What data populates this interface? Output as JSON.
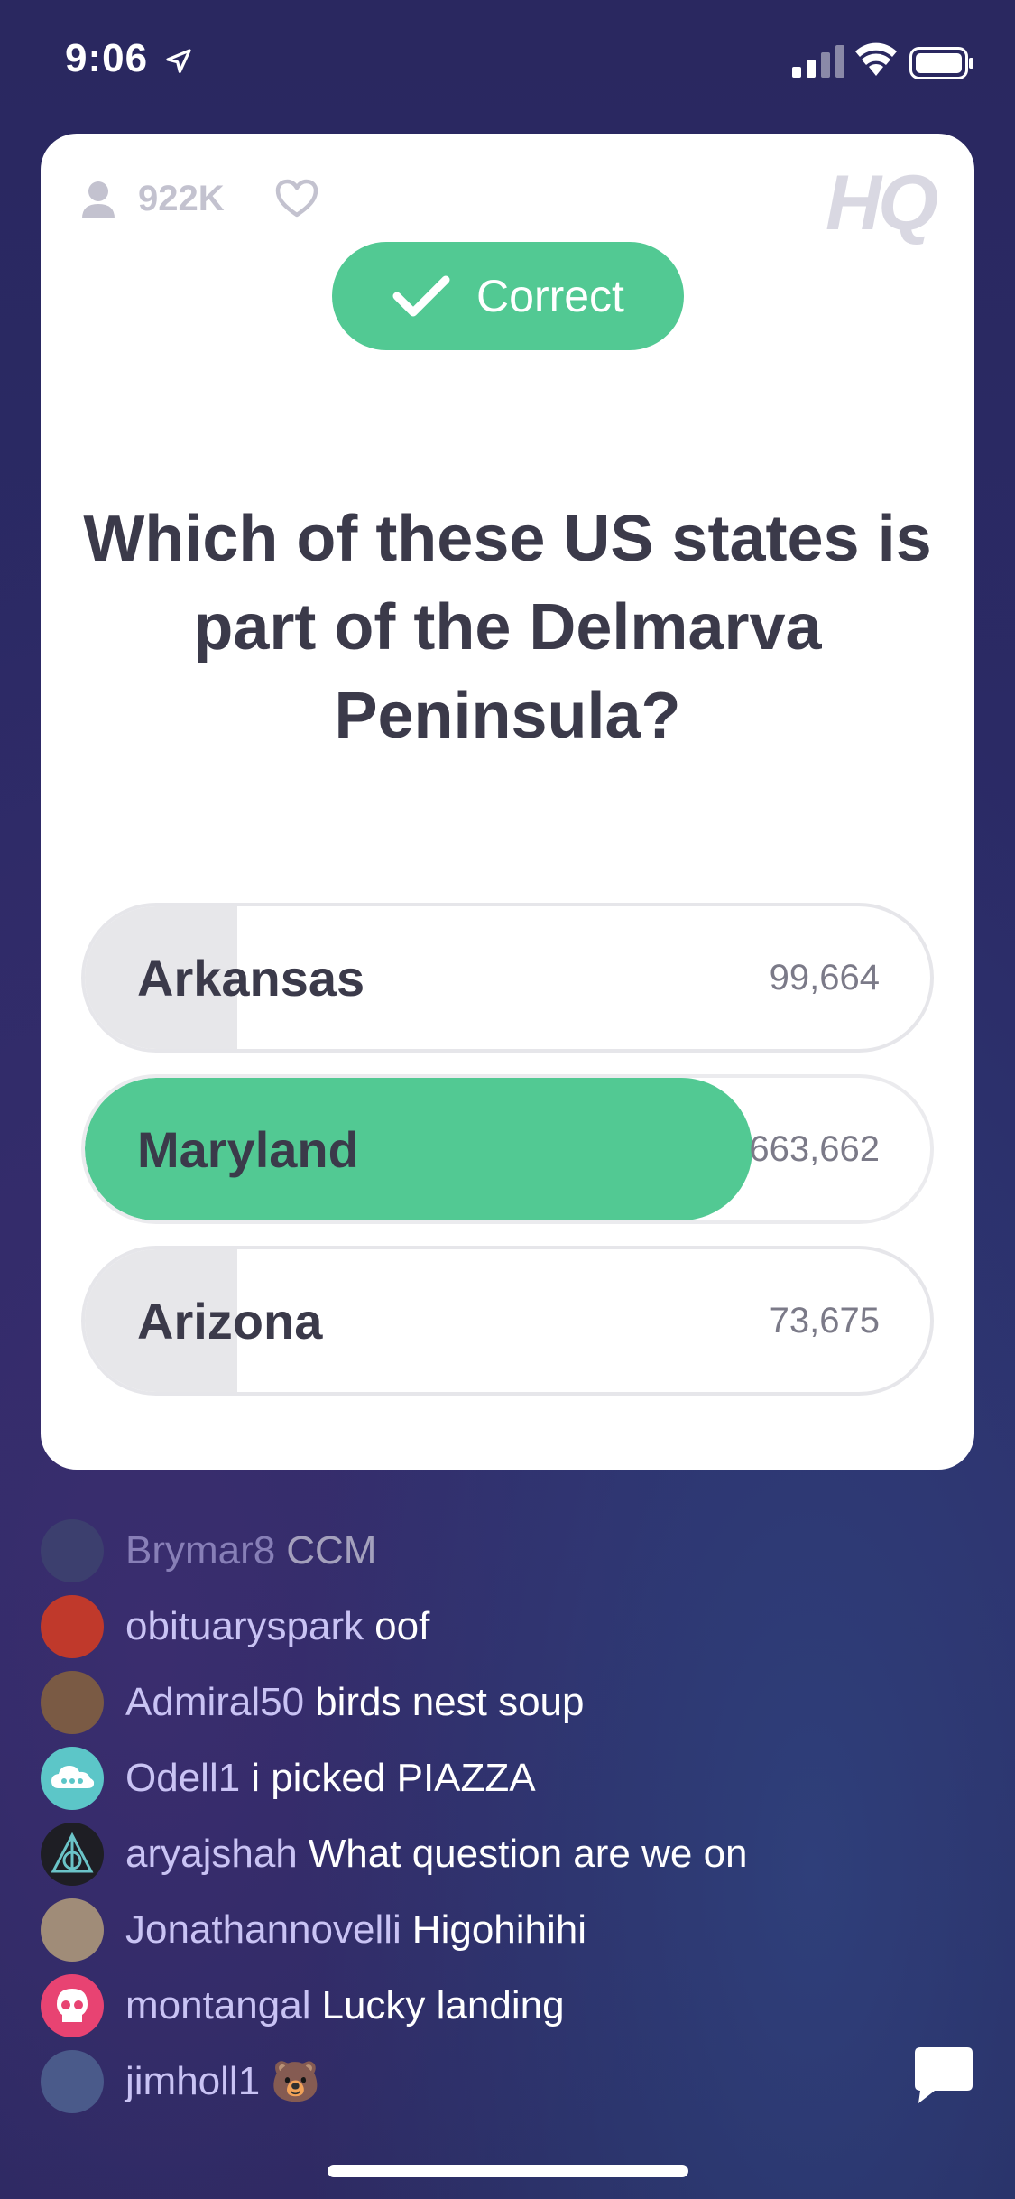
{
  "status_bar": {
    "time": "9:06"
  },
  "header": {
    "player_count": "922K",
    "logo": "HQ"
  },
  "result_badge": {
    "label": "Correct"
  },
  "question": "Which of these US states is part of the Delmarva Peninsula?",
  "answers": [
    {
      "label": "Arkansas",
      "count": "99,664",
      "fraction": 0.18,
      "correct": false
    },
    {
      "label": "Maryland",
      "count": "663,662",
      "fraction": 0.79,
      "correct": true
    },
    {
      "label": "Arizona",
      "count": "73,675",
      "fraction": 0.18,
      "correct": false
    }
  ],
  "chat": [
    {
      "user": "Brymar8",
      "text": "CCM",
      "avatar_color": "#3c3f6e"
    },
    {
      "user": "obituaryspark",
      "text": "oof",
      "avatar_color": "#c0392b"
    },
    {
      "user": "Admiral50",
      "text": "birds nest soup",
      "avatar_color": "#7a5a44"
    },
    {
      "user": "Odell1",
      "text": "i picked PIAZZA",
      "avatar_color": "#5cc6c8"
    },
    {
      "user": "aryajshah",
      "text": "What question are we on",
      "avatar_color": "#1e1e24"
    },
    {
      "user": "Jonathannovelli",
      "text": "Higohihihi",
      "avatar_color": "#a08c78"
    },
    {
      "user": "montangal",
      "text": "Lucky landing",
      "avatar_color": "#e84372"
    },
    {
      "user": "jimholl1",
      "text": "🐻",
      "avatar_color": "#4a5a8a"
    }
  ],
  "colors": {
    "correct_green": "#52c993",
    "question_text": "#3b3a4a",
    "username": "#c9c3f4"
  }
}
